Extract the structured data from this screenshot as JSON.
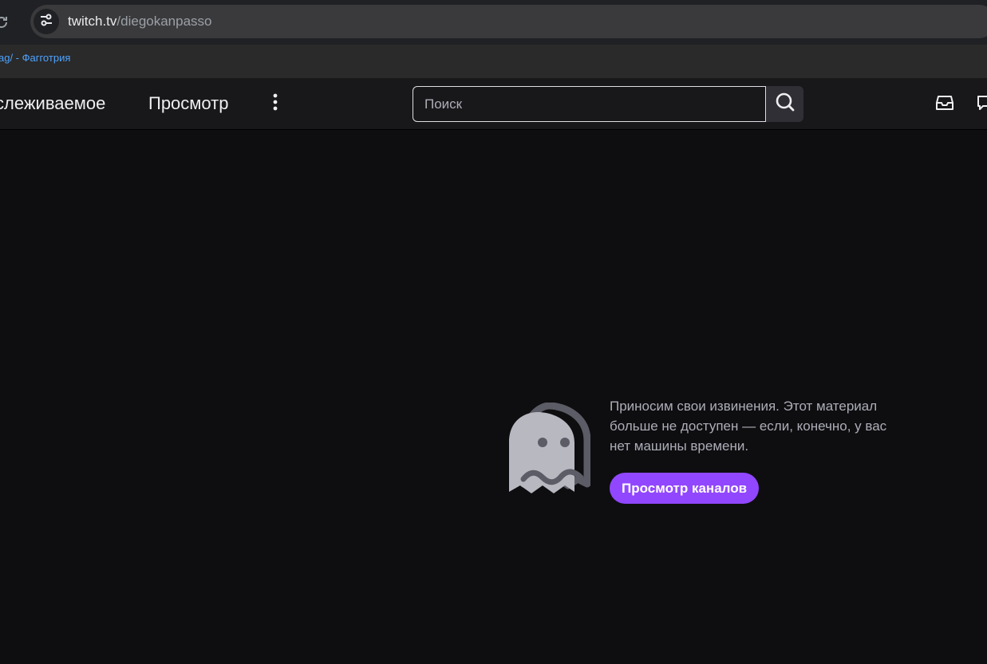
{
  "browser": {
    "url_host": "twitch.tv",
    "url_path": "/diegokanpasso",
    "bookmark_label": "ag/ - Фагготрия"
  },
  "nav": {
    "following_label": "слеживаемое",
    "browse_label": "Просмотр",
    "search_placeholder": "Поиск"
  },
  "error": {
    "message": "Приносим свои извинения. Этот материал больше не доступен — если, конечно, у вас нет машины времени.",
    "button_label": "Просмотр каналов"
  },
  "colors": {
    "accent": "#9147ff",
    "background": "#0e0e10",
    "nav_background": "#18181b",
    "text_primary": "#efeff1",
    "text_muted": "#adadb8"
  },
  "icons": {
    "reload": "reload-icon",
    "site_info": "tune-icon",
    "more": "more-vertical-icon",
    "search": "search-icon",
    "inbox": "inbox-icon",
    "whispers": "whispers-icon",
    "ghost": "ghost-icon"
  }
}
